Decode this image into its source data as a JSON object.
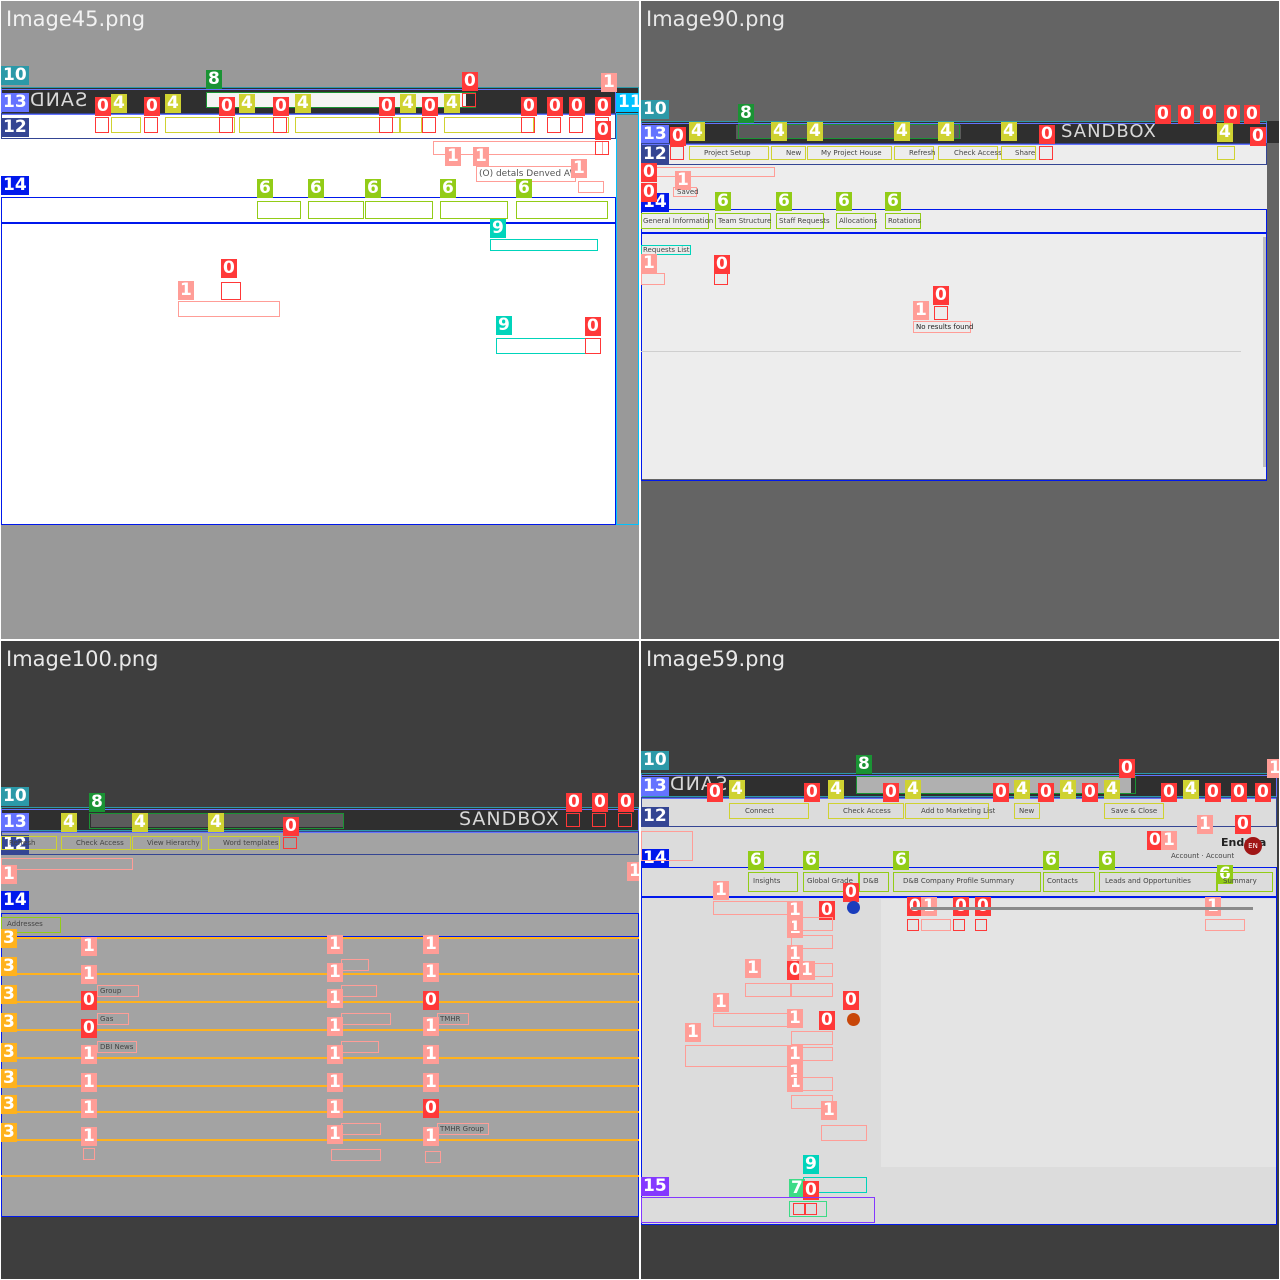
{
  "tiles": {
    "tl": {
      "title": "Image45.png"
    },
    "tr": {
      "title": "Image90.png"
    },
    "bl": {
      "title": "Image100.png"
    },
    "br": {
      "title": "Image59.png"
    }
  },
  "brand": {
    "sandbox_tr": "SANDBOX",
    "sandbox_bl": "SANDBOX",
    "sandbox_tl_mirrored": "SAND",
    "sandbox_br_mirrored": "SAND"
  },
  "tr": {
    "toolbar": [
      "Project Setup",
      "New",
      "My Project House",
      "Refresh",
      "Check Access",
      "Share"
    ],
    "tabs": [
      "General Information",
      "Team Structure",
      "Staff Requests",
      "Allocations",
      "Rotations"
    ],
    "list_title": "Requests List",
    "status": "Saved",
    "empty": "No results found"
  },
  "bl": {
    "toolbar": [
      "Refresh",
      "Check Access",
      "View Hierarchy",
      "Word templates"
    ],
    "tab": "Addresses",
    "rows_values_col3": [
      "TMHR",
      "TMHR Group"
    ],
    "rows_values_col1": [
      "Group",
      "Gas",
      "DBI News"
    ]
  },
  "br": {
    "toolbar": [
      "Connect",
      "Check Access",
      "Add to Marketing List",
      "New",
      "Save & Close"
    ],
    "tabs": [
      "Summary",
      "Leads and Opportunities",
      "Contacts",
      "D&B Company Profile Summary",
      "D&B",
      "Global Grade",
      "Insights"
    ],
    "account_name": "Endava",
    "account_sub": "Account · Account",
    "avatar_initials": "EN"
  },
  "colors": {
    "class0": "#ff3838",
    "class1": "#ff9d97",
    "class3": "#ffb21d",
    "class4": "#cfd231",
    "class6": "#92cc17",
    "class7": "#3ddb86",
    "class8": "#1a9334",
    "class9": "#00d4bb",
    "class10": "#2c99a8",
    "class11": "#00c2ff",
    "class12": "#344593",
    "class13": "#6473ff",
    "class14": "#0018ec",
    "class15": "#8438ff"
  }
}
